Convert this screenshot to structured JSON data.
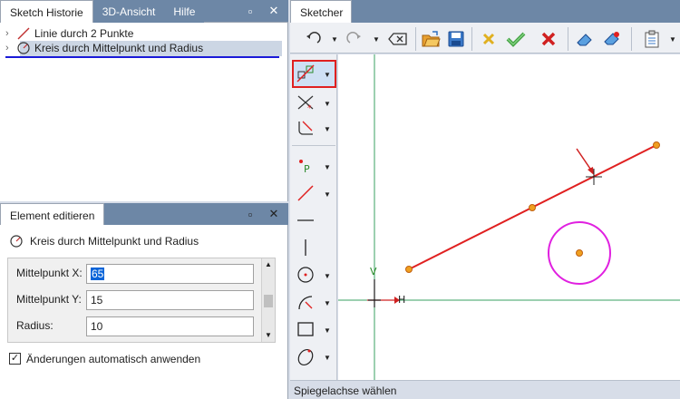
{
  "history_panel": {
    "tabs": [
      {
        "label": "Sketch Historie"
      },
      {
        "label": "3D-Ansicht"
      },
      {
        "label": "Hilfe"
      }
    ],
    "items": [
      {
        "label": "Linie durch 2 Punkte",
        "icon": "line-icon",
        "selected": false
      },
      {
        "label": "Kreis durch Mittelpunkt und Radius",
        "icon": "circle-radius-icon",
        "selected": true
      }
    ]
  },
  "edit_panel": {
    "tab_label": "Element editieren",
    "element_title": "Kreis durch Mittelpunkt und Radius",
    "fields": [
      {
        "label": "Mittelpunkt X:",
        "value": "65"
      },
      {
        "label": "Mittelpunkt Y:",
        "value": "15"
      },
      {
        "label": "Radius:",
        "value": "10"
      }
    ],
    "auto_apply": {
      "label": "Änderungen automatisch anwenden",
      "checked": true
    }
  },
  "sketcher": {
    "tab_label": "Sketcher",
    "status_text": "Spiegelachse wählen",
    "toolbar_icons": [
      "undo-icon",
      "redo-icon",
      "delete-backspace-icon",
      "open-folder-icon",
      "save-icon",
      "cancel-cross-icon",
      "accept-check-icon",
      "close-red-x-icon",
      "eraser-icon",
      "eraser-special-icon",
      "clipboard-icon"
    ],
    "left_tools": [
      "mirror-tool-icon",
      "trim-tool-icon",
      "fillet-tool-icon",
      "point-tool-icon",
      "line-tool-icon",
      "horizontal-line-icon",
      "vertical-line-icon",
      "circle-tool-icon",
      "arc-tool-icon",
      "rectangle-tool-icon",
      "ellipse-tool-icon"
    ],
    "axis_labels": {
      "x": "H",
      "y": "V"
    },
    "colors": {
      "accent_red": "#e02020",
      "line_red": "#e02020",
      "circle_magenta": "#e020e0",
      "axis_green": "#3aa060",
      "point_orange": "#f0a020"
    }
  }
}
